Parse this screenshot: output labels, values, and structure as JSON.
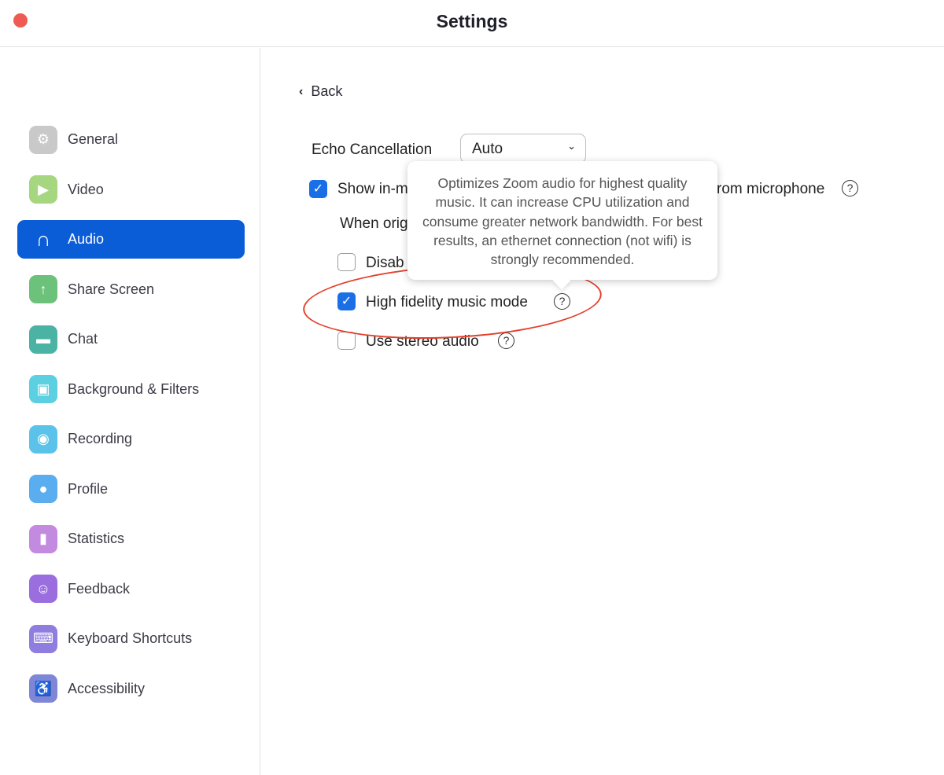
{
  "window": {
    "title": "Settings"
  },
  "sidebar": {
    "items": [
      {
        "label": "General",
        "icon": "gear-icon",
        "color": "#c9c9c9",
        "glyph": "⚙"
      },
      {
        "label": "Video",
        "icon": "video-camera-icon",
        "color": "#a6d67f",
        "glyph": "▶"
      },
      {
        "label": "Audio",
        "icon": "headphones-icon",
        "color": "#0b5cd7",
        "glyph": "∩",
        "active": true
      },
      {
        "label": "Share Screen",
        "icon": "share-screen-icon",
        "color": "#6cc27a",
        "glyph": "↑"
      },
      {
        "label": "Chat",
        "icon": "chat-bubble-icon",
        "color": "#4bb3a4",
        "glyph": "▬"
      },
      {
        "label": "Background & Filters",
        "icon": "background-icon",
        "color": "#5ccfe0",
        "glyph": "▣"
      },
      {
        "label": "Recording",
        "icon": "record-icon",
        "color": "#5bc3ea",
        "glyph": "◉"
      },
      {
        "label": "Profile",
        "icon": "profile-icon",
        "color": "#5aaef0",
        "glyph": "●"
      },
      {
        "label": "Statistics",
        "icon": "bar-chart-icon",
        "color": "#c38be0",
        "glyph": "▮"
      },
      {
        "label": "Feedback",
        "icon": "smiley-icon",
        "color": "#9b6ee0",
        "glyph": "☺"
      },
      {
        "label": "Keyboard Shortcuts",
        "icon": "keyboard-icon",
        "color": "#8f7ee0",
        "glyph": "⌨"
      },
      {
        "label": "Accessibility",
        "icon": "accessibility-icon",
        "color": "#7f86d6",
        "glyph": "♿"
      }
    ]
  },
  "main": {
    "back_label": "Back",
    "echo_label": "Echo Cancellation",
    "echo_value": "Auto",
    "show_label_start": "Show in-m",
    "show_label_end": "rom microphone",
    "when_label": "When orig",
    "disable_label": "Disab",
    "hifi_label": "High fidelity music mode",
    "stereo_label": "Use stereo audio",
    "tooltip": "Optimizes Zoom audio for highest quality music. It can increase CPU utilization and consume greater network bandwidth. For best results, an ethernet connection (not wifi) is strongly recommended."
  },
  "colors": {
    "accent": "#0b5cd7",
    "annotation": "#e2412c"
  }
}
